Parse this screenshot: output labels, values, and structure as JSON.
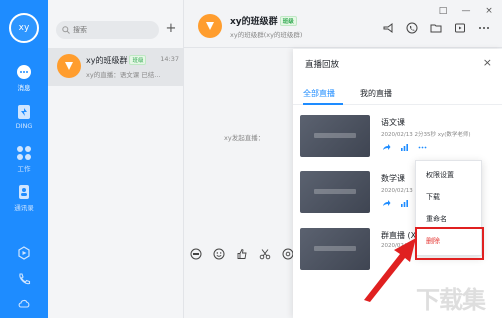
{
  "user": {
    "avatar_text": "xy"
  },
  "nav": [
    {
      "label": "消息",
      "icon": "chat-icon"
    },
    {
      "label": "DING",
      "icon": "ding-icon"
    },
    {
      "label": "工作",
      "icon": "grid-icon"
    },
    {
      "label": "通讯录",
      "icon": "contacts-icon"
    }
  ],
  "search": {
    "placeholder": "搜索"
  },
  "conversation": {
    "name": "xy的班级群",
    "tag": "班级",
    "time": "14:37",
    "preview": "xy的直播：语文课 已结..."
  },
  "chat": {
    "title": "xy的班级群",
    "tag": "班级",
    "subtitle": "xy的班级群(xy的班级群)",
    "system_messages": [
      "xy发起直播："
    ]
  },
  "window_controls": [
    "□",
    "—",
    "×"
  ],
  "panel": {
    "title": "直播回放",
    "close": "×",
    "tabs": [
      "全部直播",
      "我的直播"
    ],
    "records": [
      {
        "title": "语文课",
        "meta": "2020/02/13 2分35秒 xy(数学老师)"
      },
      {
        "title": "数学课",
        "meta": "2020/02/13 ... xy(数学老师)"
      },
      {
        "title": "群直播 (X...",
        "meta": "2020/02/13 ..."
      }
    ]
  },
  "context_menu": {
    "items": [
      "权限设置",
      "下载",
      "重命名",
      "删除"
    ]
  },
  "watermark": "下载集"
}
